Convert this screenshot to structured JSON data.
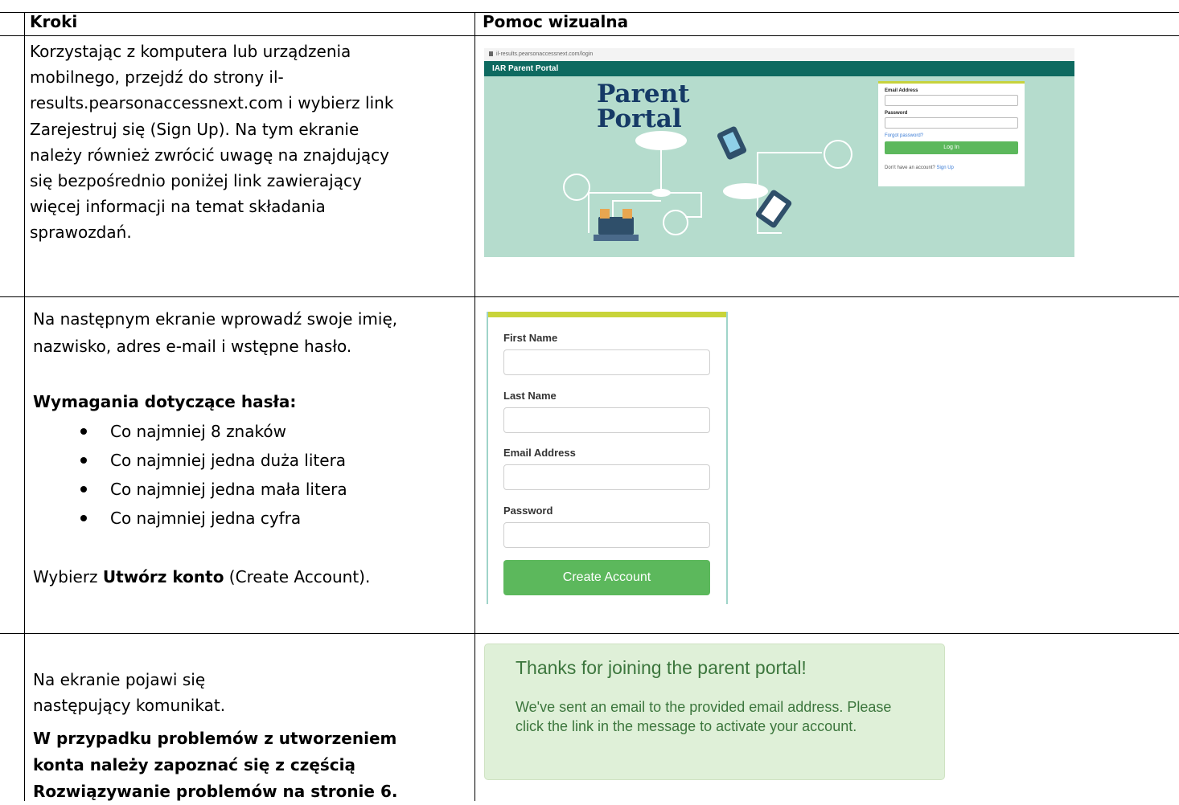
{
  "table": {
    "headers": [
      "Kroki",
      "Pomoc wizualna"
    ],
    "rows": [
      {
        "text": "Korzystając z komputera lub urządzenia mobilnego, przejdź do strony il-results.pearsonaccessnext.com i wybierz link Zarejestruj się (Sign Up). Na tym ekranie należy również zwrócić uwagę na znajdujący się bezpośrednio poniżej link zawierający więcej informacji na temat składania sprawozdań."
      },
      {
        "intro": "Na następnym ekranie wprowadź swoje imię, nazwisko, adres e-mail i wstępne hasło.",
        "req_title": "Wymagania dotyczące hasła:",
        "requirements": [
          "Co najmniej 8 znaków",
          "Co najmniej jedna duża litera",
          "Co najmniej jedna mała litera",
          "Co najmniej jedna cyfra"
        ],
        "choose_pre": "Wybierz ",
        "choose_bold": "Utwórz konto",
        "choose_post": " (Create Account)."
      },
      {
        "text": "Na ekranie pojawi się następujący komunikat.",
        "bold": "W przypadku problemów z utworzeniem konta należy zapoznać się z częścią Rozwiązywanie problemów na stronie 6."
      }
    ]
  },
  "screenshot_login": {
    "url": "il-results.pearsonaccessnext.com/login",
    "nav_title": "IAR Parent Portal",
    "hero_title_1": "Parent",
    "hero_title_2": "Portal",
    "email_label": "Email Address",
    "password_label": "Password",
    "forgot": "Forgot password?",
    "login_button": "Log In",
    "no_account": "Don't have an account?",
    "sign_up": "Sign Up",
    "bg_color": "#b5dccd",
    "nav_color": "#0e6a60"
  },
  "screenshot_signup": {
    "first_name": "First Name",
    "last_name": "Last Name",
    "email": "Email Address",
    "password": "Password",
    "button": "Create Account",
    "button_color": "#5cb85c"
  },
  "screenshot_thanks": {
    "heading": "Thanks for joining the parent portal!",
    "message": "We've sent an email to the provided email address. Please click the link in the message to activate your account.",
    "bg_color": "#dff0d8"
  }
}
